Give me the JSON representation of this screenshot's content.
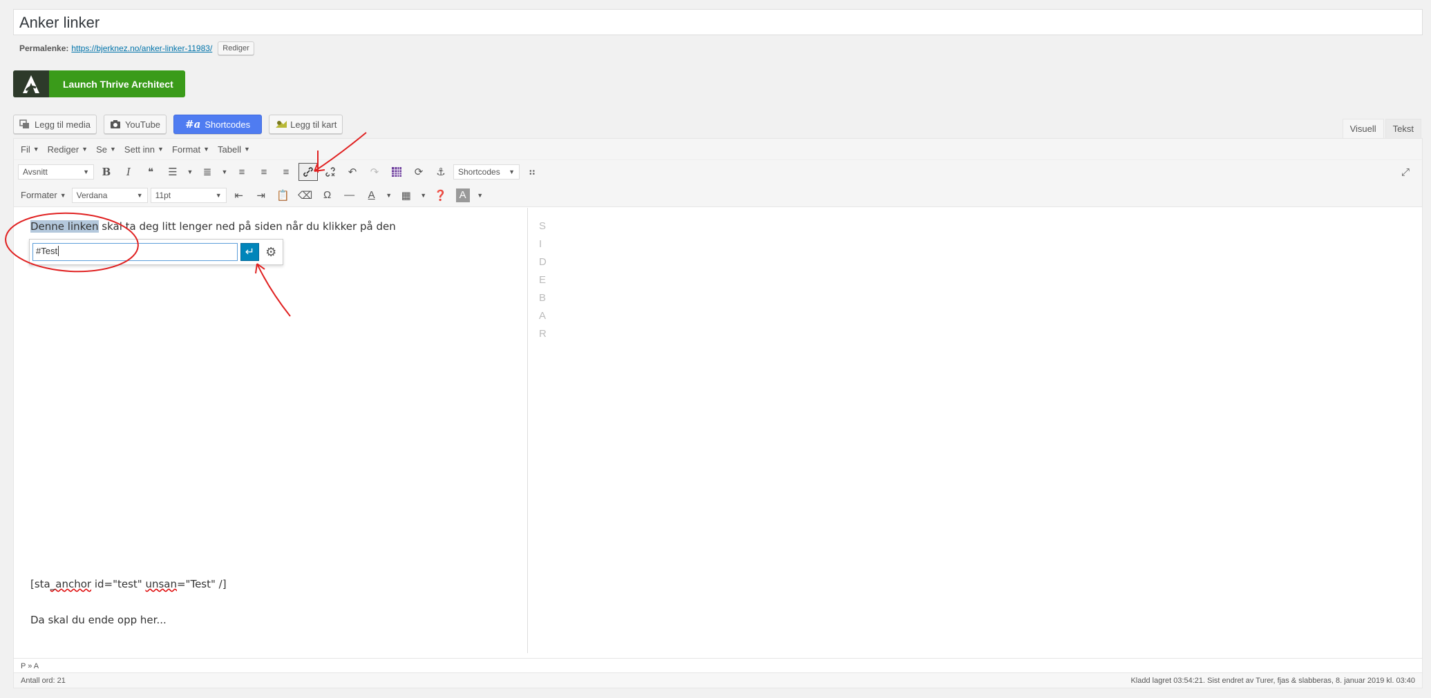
{
  "post": {
    "title": "Anker linker",
    "permalink_label": "Permalenke:",
    "permalink_url_base": "https://bjerknez.no/",
    "permalink_slug": "anker-linker-11983",
    "permalink_suffix": "/",
    "edit_label": "Rediger"
  },
  "thrive": {
    "label": "Launch Thrive Architect"
  },
  "media_buttons": {
    "add_media": "Legg til media",
    "youtube": "YouTube",
    "shortcodes": "Shortcodes",
    "add_map": "Legg til kart"
  },
  "editor_tabs": {
    "visual": "Visuell",
    "text": "Tekst"
  },
  "menubar": [
    "Fil",
    "Rediger",
    "Se",
    "Sett inn",
    "Format",
    "Tabell"
  ],
  "toolbar": {
    "paragraph_select": "Avsnitt",
    "shortcodes_select": "Shortcodes",
    "formats_select": "Formater",
    "font_select": "Verdana",
    "size_select": "11pt"
  },
  "content": {
    "p1_highlight": "Denne linken",
    "p1_rest": " skal ta deg litt lenger ned på siden når du klikker på den",
    "link_value": "#Test",
    "p2_a": "[sta",
    "p2_b": "_anchor",
    "p2_c": " id=\"test\" ",
    "p2_d": "unsan",
    "p2_e": "=\"Test\" /]",
    "p3": "Da skal du ende opp her..."
  },
  "sidebar_letters": [
    "S",
    "I",
    "D",
    "E",
    "B",
    "A",
    "R"
  ],
  "status": {
    "path": "P » A",
    "word_count": "Antall ord: 21",
    "saved": "Kladd lagret 03:54:21. Sist endret av Turer, fjas & slabberas, 8. januar 2019 kl. 03:40"
  },
  "colors": {
    "thrive_green": "#3a9b1a",
    "shortcodes_blue": "#4f7cf1",
    "apply_blue": "#0085ba",
    "annotation_red": "#e02020"
  }
}
